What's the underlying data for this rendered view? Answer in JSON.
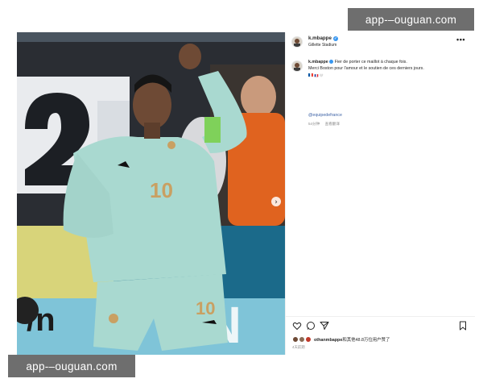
{
  "watermark": {
    "top": "app-–ouguan.com",
    "bottom": "app-–ouguan.com"
  },
  "post": {
    "header": {
      "username": "k.mbappe",
      "location": "Gillette Stadium",
      "more_label": "•••",
      "verified_mark": "✓"
    },
    "caption": {
      "username": "k.mbappe",
      "line1": "Fier de porter ce maillot à chaque fois.",
      "line2": "Merci Boston pour l'amour et le soutien de ces derniers jours.",
      "emoji_line": "🇫🇷 🤍",
      "hashtag": "@equipedefrance",
      "time_ago": "54分钟",
      "translate_label": "查看翻译"
    },
    "photo": {
      "jersey_number": "10",
      "next_arrow": "›",
      "subject": "Football player in a mint-green France jersey number 10 waving"
    },
    "actions": {
      "like_icon": "heart-icon",
      "comment_icon": "comment-icon",
      "share_icon": "send-icon",
      "save_icon": "bookmark-icon"
    },
    "likes": {
      "username": "othanmbappe",
      "rest": "和其他48.8万位用户赞了"
    },
    "date": "4天前期"
  },
  "colors": {
    "verified": "#3897f0",
    "link": "#3e63a6",
    "jersey": "#a9d9d0",
    "text": "#262626",
    "muted": "#8e8e8e"
  }
}
